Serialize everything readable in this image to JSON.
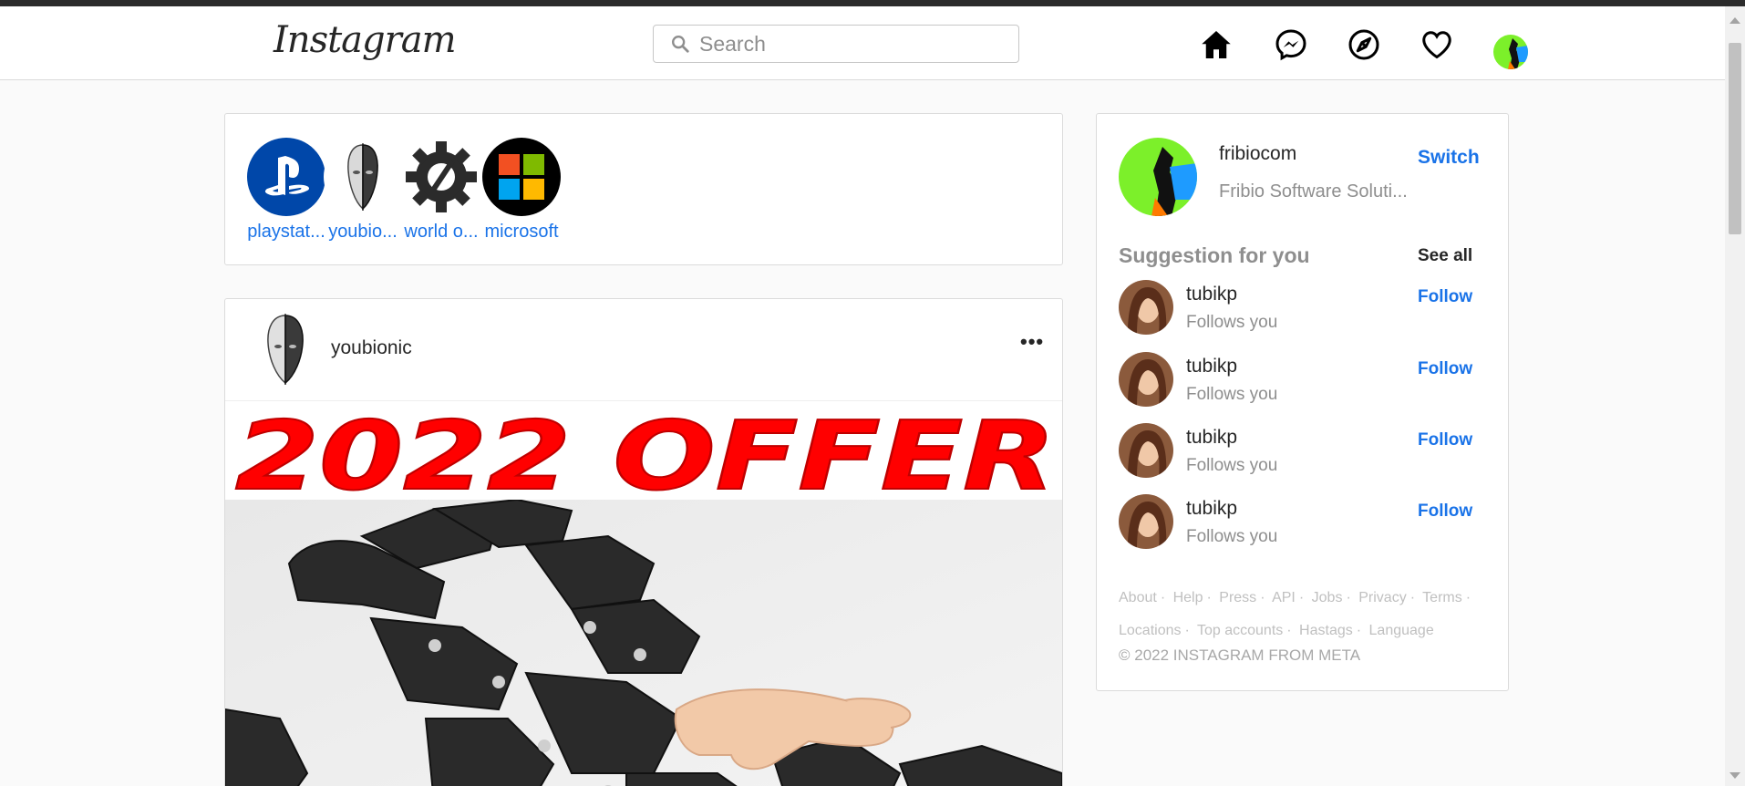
{
  "header": {
    "logo": "Instagram",
    "search_placeholder": "Search"
  },
  "nav_icons": [
    "home-icon",
    "messenger-icon",
    "explore-icon",
    "heart-icon",
    "profile-avatar"
  ],
  "stories": [
    {
      "label": "playstat...",
      "icon": "playstation-logo",
      "color": "#0047a9"
    },
    {
      "label": "youbio...",
      "icon": "youbionic-face-logo",
      "color": "#ffffff"
    },
    {
      "label": "world o...",
      "icon": "gear-logo",
      "color": "#2b2b2b"
    },
    {
      "label": "microsoft",
      "icon": "microsoft-logo",
      "color": "#000000"
    }
  ],
  "post": {
    "username": "youbionic",
    "more": "•••",
    "image_banner": "2022 OFFER"
  },
  "sidebar": {
    "username": "fribiocom",
    "subtitle": "Fribio Software Soluti...",
    "switch_label": "Switch",
    "suggestions_title": "Suggestion for you",
    "see_all": "See all",
    "suggestions": [
      {
        "name": "tubikp",
        "sub": "Follows you",
        "action": "Follow"
      },
      {
        "name": "tubikp",
        "sub": "Follows you",
        "action": "Follow"
      },
      {
        "name": "tubikp",
        "sub": "Follows you",
        "action": "Follow"
      },
      {
        "name": "tubikp",
        "sub": "Follows you",
        "action": "Follow"
      }
    ],
    "footer_line1": [
      "About",
      "Help",
      "Press",
      "API",
      "Jobs",
      "Privacy",
      "Terms"
    ],
    "footer_line2": [
      "Locations",
      "Top accounts",
      "Hastags",
      "Language"
    ],
    "copyright": "© 2022 INSTAGRAM FROM META"
  },
  "colors": {
    "link_blue": "#1a73e8",
    "avatar_green": "#7cf02a",
    "offer_red": "#ff0000"
  }
}
